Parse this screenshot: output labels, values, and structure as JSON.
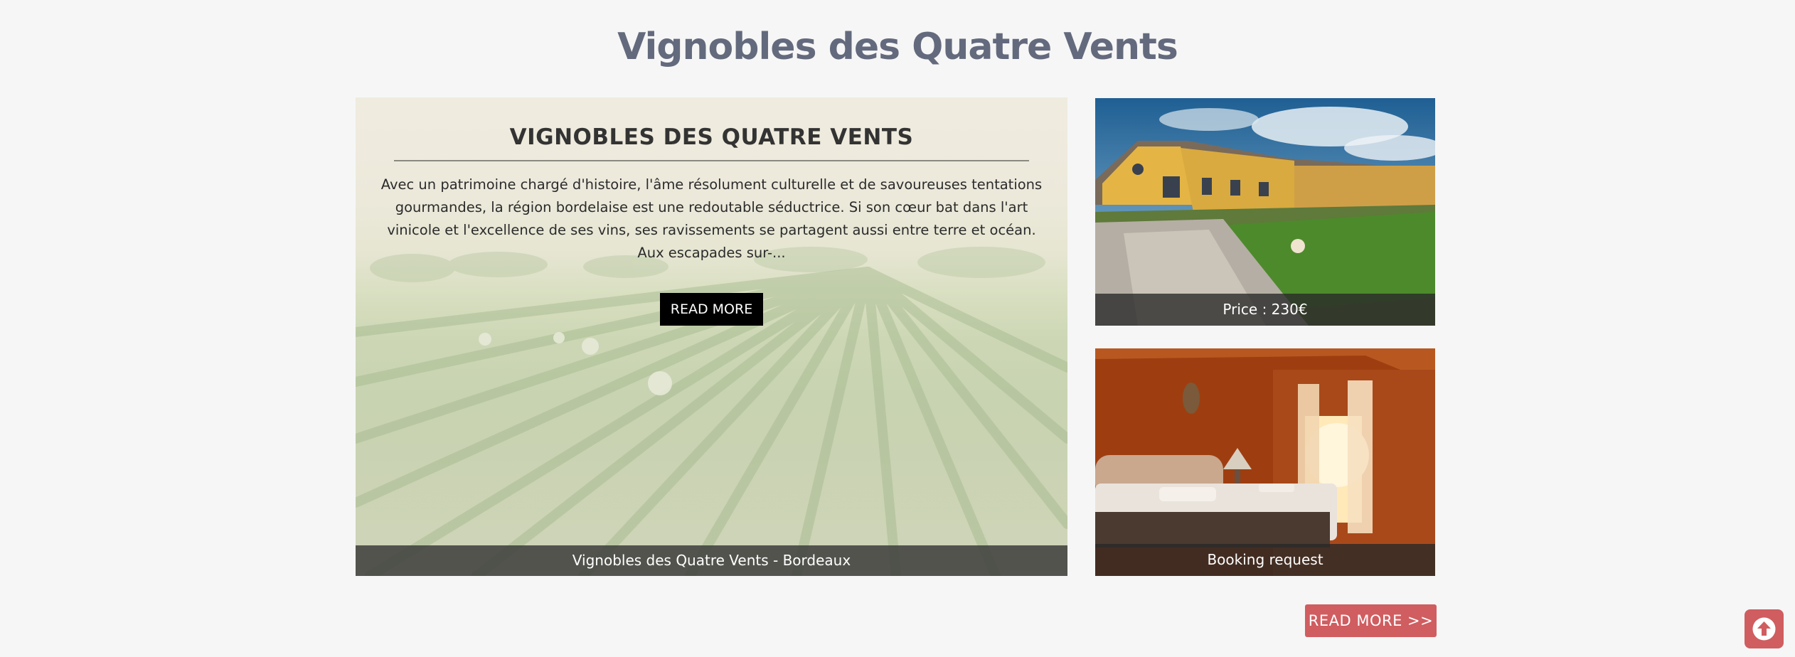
{
  "page": {
    "title": "Vignobles des Quatre Vents"
  },
  "featured": {
    "heading": "VIGNOBLES DES QUATRE VENTS",
    "text": "Avec un patrimoine chargé d'histoire, l'âme résolument culturelle et de savoureuses tentations gourmandes, la région bordelaise est une redoutable séductrice. Si son cœur bat dans l'art vinicole et l'excellence de ses vins, ses ravissements se partagent aussi entre terre et océan. Aux escapades sur-...",
    "button_label": "READ MORE",
    "caption": "Vignobles des Quatre Vents - Bordeaux"
  },
  "cards": [
    {
      "caption": "Price : 230€"
    },
    {
      "caption": "Booking request"
    }
  ],
  "read_more": {
    "label": "READ MORE >>"
  },
  "colors": {
    "accent": "#d05d60",
    "title": "#646a7d"
  },
  "icons": {
    "scroll_top": "arrow-up-circle-icon"
  }
}
